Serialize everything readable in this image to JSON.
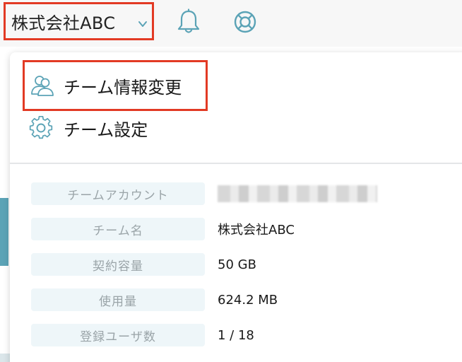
{
  "topbar": {
    "team_name": "株式会社ABC",
    "icons": {
      "chevron": "chevron-down-icon",
      "notifications": "bell-icon",
      "help": "lifebuoy-icon"
    }
  },
  "menu": {
    "items": [
      {
        "label": "チーム情報変更",
        "icon": "team-users-icon",
        "highlighted": true
      },
      {
        "label": "チーム設定",
        "icon": "gear-icon",
        "highlighted": false
      }
    ]
  },
  "info": {
    "rows": [
      {
        "label": "チームアカウント",
        "value": ""
      },
      {
        "label": "チーム名",
        "value": "株式会社ABC"
      },
      {
        "label": "契約容量",
        "value": "50 GB"
      },
      {
        "label": "使用量",
        "value": "624.2 MB"
      },
      {
        "label": "登録ユーザ数",
        "value": "1 / 18"
      }
    ]
  },
  "colors": {
    "highlight_border": "#e23a24",
    "icon_accent": "#5ba3b6",
    "label_bg": "#eef6f9",
    "label_text": "#9aa4a8"
  }
}
